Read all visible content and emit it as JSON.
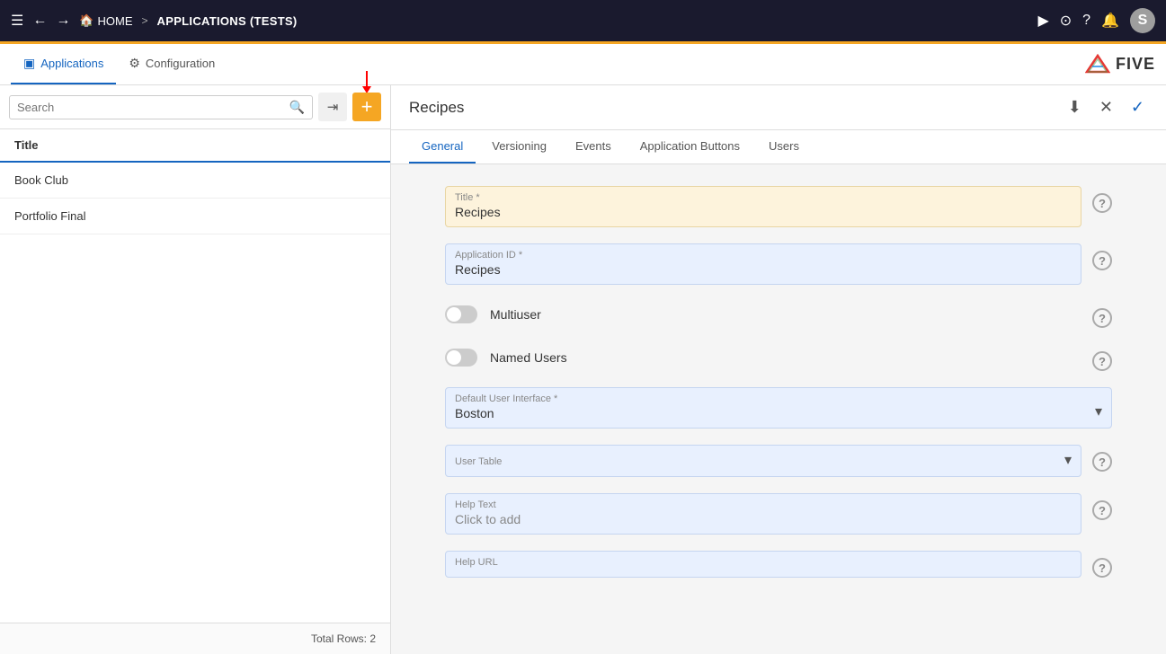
{
  "topNav": {
    "menuIcon": "☰",
    "backIcon": "←",
    "forwardIcon": "→",
    "homeLabel": "HOME",
    "separator1": ">",
    "breadcrumb": "APPLICATIONS (TESTS)",
    "playIcon": "▶",
    "searchNavIcon": "⊙",
    "helpIcon": "?",
    "bellIcon": "🔔",
    "userInitial": "S"
  },
  "tabBar": {
    "tabs": [
      {
        "id": "applications",
        "label": "Applications",
        "icon": "▣",
        "active": true
      },
      {
        "id": "configuration",
        "label": "Configuration",
        "icon": "⚙",
        "active": false
      }
    ],
    "logoText": "FIVE"
  },
  "sidebar": {
    "searchPlaceholder": "Search",
    "headerTitle": "Title",
    "items": [
      {
        "id": "book-club",
        "label": "Book Club"
      },
      {
        "id": "portfolio-final",
        "label": "Portfolio Final"
      }
    ],
    "footerText": "Total Rows: 2"
  },
  "rightPanel": {
    "title": "Recipes",
    "downloadIcon": "⬇",
    "closeIcon": "✕",
    "checkIcon": "✓",
    "tabs": [
      {
        "id": "general",
        "label": "General",
        "active": true
      },
      {
        "id": "versioning",
        "label": "Versioning",
        "active": false
      },
      {
        "id": "events",
        "label": "Events",
        "active": false
      },
      {
        "id": "application-buttons",
        "label": "Application Buttons",
        "active": false
      },
      {
        "id": "users",
        "label": "Users",
        "active": false
      }
    ],
    "form": {
      "titleField": {
        "label": "Title *",
        "value": "Recipes"
      },
      "applicationIdField": {
        "label": "Application ID *",
        "value": "Recipes"
      },
      "multiuserField": {
        "label": "Multiuser",
        "enabled": false
      },
      "namedUsersField": {
        "label": "Named Users",
        "enabled": false
      },
      "defaultUserInterfaceField": {
        "label": "Default User Interface *",
        "value": "Boston"
      },
      "userTableField": {
        "label": "User Table",
        "value": ""
      },
      "helpTextField": {
        "label": "Help Text",
        "value": "Click to add"
      },
      "helpUrlField": {
        "label": "Help URL",
        "value": ""
      }
    }
  },
  "helpIcon": "?"
}
